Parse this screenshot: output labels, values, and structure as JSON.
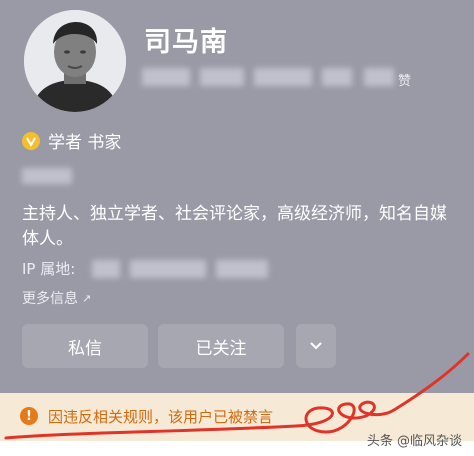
{
  "profile": {
    "name": "司马南",
    "likes_suffix": "赞",
    "badge": "学者 书家",
    "bio": "主持人、独立学者、社会评论家，高级经济师，知名自媒体人。",
    "ip_label": "IP 属地:",
    "more_info": "更多信息"
  },
  "actions": {
    "message": "私信",
    "follow": "已关注"
  },
  "banner": {
    "text": "因违反相关规则，该用户已被禁言",
    "accent": "#e57a18"
  },
  "watermark": "头条 @临风杂谈"
}
